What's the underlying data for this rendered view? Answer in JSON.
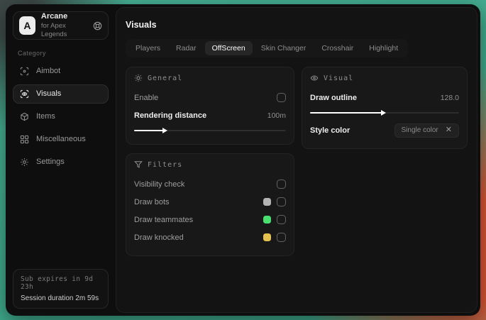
{
  "app": {
    "name": "Arcane",
    "subtitle": "for Apex Legends",
    "logo_letter": "A"
  },
  "sidebar": {
    "category_label": "Category",
    "items": [
      {
        "label": "Aimbot"
      },
      {
        "label": "Visuals"
      },
      {
        "label": "Items"
      },
      {
        "label": "Miscellaneous"
      },
      {
        "label": "Settings"
      }
    ],
    "active_item": "Visuals",
    "status": {
      "sub_expires": "Sub expires in 9d 23h",
      "session_duration": "Session duration 2m 59s"
    }
  },
  "main": {
    "title": "Visuals",
    "tabs": [
      "Players",
      "Radar",
      "OffScreen",
      "Skin Changer",
      "Crosshair",
      "Highlight"
    ],
    "active_tab": "OffScreen",
    "general": {
      "title": "General",
      "enable_label": "Enable",
      "enable_checked": false,
      "rendering_distance_label": "Rendering distance",
      "rendering_distance_value": "100m",
      "rendering_distance_fill": "21%"
    },
    "visual": {
      "title": "Visual",
      "draw_outline_label": "Draw outline",
      "draw_outline_value": "128.0",
      "draw_outline_fill": "50%",
      "style_color_label": "Style color",
      "style_color_value": "Single color"
    },
    "filters": {
      "title": "Filters",
      "rows": [
        {
          "label": "Visibility check",
          "checked": false
        },
        {
          "label": "Draw bots",
          "swatch": "#b3b3b3",
          "checked": false
        },
        {
          "label": "Draw teammates",
          "swatch": "#4ade70",
          "checked": false
        },
        {
          "label": "Draw knocked",
          "swatch": "#e3c24f",
          "checked": false
        }
      ]
    }
  },
  "colors": {
    "bots_swatch": "#b3b3b3",
    "teammates_swatch": "#4ade70",
    "knocked_swatch": "#e3c24f",
    "background_teal": "#43ae91",
    "background_orange": "#dd5130"
  }
}
